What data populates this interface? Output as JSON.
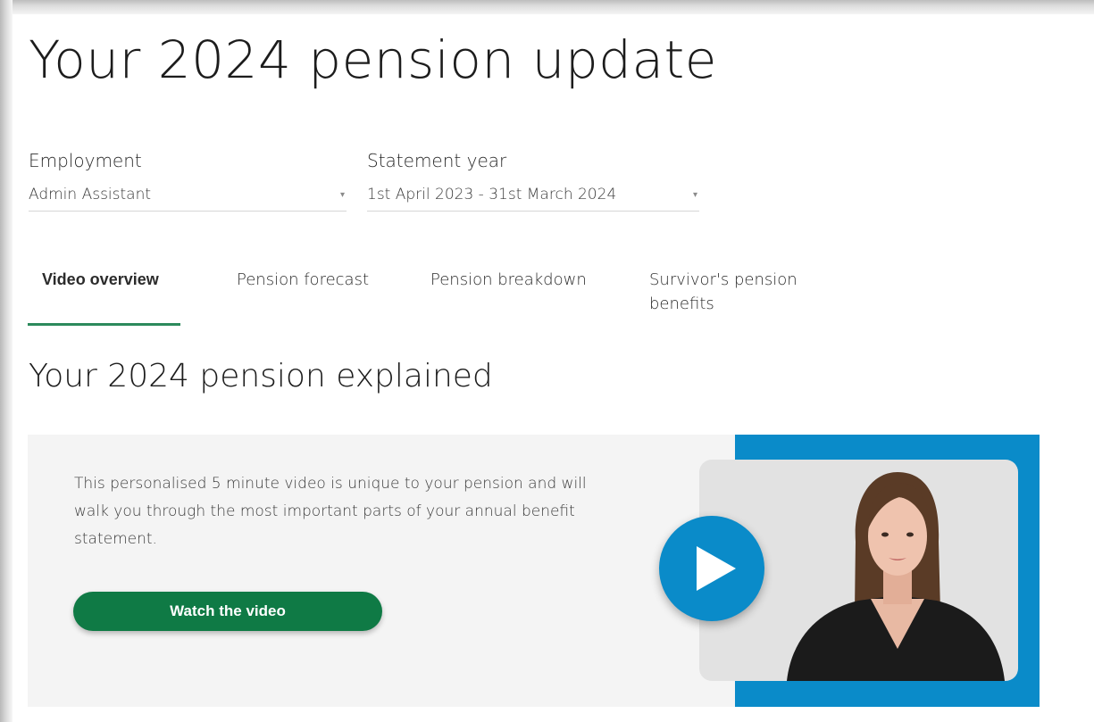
{
  "page": {
    "title": "Your 2024 pension update"
  },
  "filters": {
    "employment": {
      "label": "Employment",
      "selected": "Admin Assistant"
    },
    "statement_year": {
      "label": "Statement year",
      "selected": "1st April 2023 - 31st March 2024"
    }
  },
  "tabs": [
    {
      "label": "Video overview",
      "active": true
    },
    {
      "label": "Pension forecast",
      "active": false
    },
    {
      "label": "Pension breakdown",
      "active": false
    },
    {
      "label": "Survivor's pension benefits",
      "active": false
    }
  ],
  "video_section": {
    "heading": "Your 2024 pension explained",
    "description": "This personalised 5 minute video is unique to your pension and will walk you through the most important parts of your annual benefit statement.",
    "button_label": "Watch the video"
  },
  "icons": {
    "dropdown": "chevron-down-icon",
    "play": "play-icon",
    "presenter": "presenter-avatar"
  },
  "colors": {
    "accent_green": "#0f7a45",
    "tab_underline": "#2c8a5c",
    "video_blue": "#0a8bc9",
    "panel_bg": "#f4f4f4"
  }
}
